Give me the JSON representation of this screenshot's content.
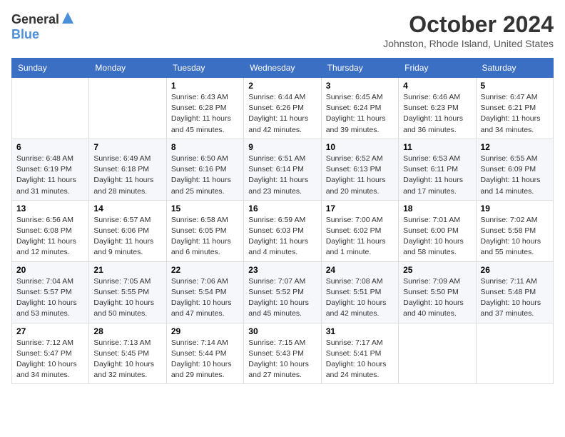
{
  "logo": {
    "general": "General",
    "blue": "Blue"
  },
  "title": "October 2024",
  "location": "Johnston, Rhode Island, United States",
  "days_of_week": [
    "Sunday",
    "Monday",
    "Tuesday",
    "Wednesday",
    "Thursday",
    "Friday",
    "Saturday"
  ],
  "weeks": [
    [
      {
        "day": "",
        "sunrise": "",
        "sunset": "",
        "daylight": ""
      },
      {
        "day": "",
        "sunrise": "",
        "sunset": "",
        "daylight": ""
      },
      {
        "day": "1",
        "sunrise": "Sunrise: 6:43 AM",
        "sunset": "Sunset: 6:28 PM",
        "daylight": "Daylight: 11 hours and 45 minutes."
      },
      {
        "day": "2",
        "sunrise": "Sunrise: 6:44 AM",
        "sunset": "Sunset: 6:26 PM",
        "daylight": "Daylight: 11 hours and 42 minutes."
      },
      {
        "day": "3",
        "sunrise": "Sunrise: 6:45 AM",
        "sunset": "Sunset: 6:24 PM",
        "daylight": "Daylight: 11 hours and 39 minutes."
      },
      {
        "day": "4",
        "sunrise": "Sunrise: 6:46 AM",
        "sunset": "Sunset: 6:23 PM",
        "daylight": "Daylight: 11 hours and 36 minutes."
      },
      {
        "day": "5",
        "sunrise": "Sunrise: 6:47 AM",
        "sunset": "Sunset: 6:21 PM",
        "daylight": "Daylight: 11 hours and 34 minutes."
      }
    ],
    [
      {
        "day": "6",
        "sunrise": "Sunrise: 6:48 AM",
        "sunset": "Sunset: 6:19 PM",
        "daylight": "Daylight: 11 hours and 31 minutes."
      },
      {
        "day": "7",
        "sunrise": "Sunrise: 6:49 AM",
        "sunset": "Sunset: 6:18 PM",
        "daylight": "Daylight: 11 hours and 28 minutes."
      },
      {
        "day": "8",
        "sunrise": "Sunrise: 6:50 AM",
        "sunset": "Sunset: 6:16 PM",
        "daylight": "Daylight: 11 hours and 25 minutes."
      },
      {
        "day": "9",
        "sunrise": "Sunrise: 6:51 AM",
        "sunset": "Sunset: 6:14 PM",
        "daylight": "Daylight: 11 hours and 23 minutes."
      },
      {
        "day": "10",
        "sunrise": "Sunrise: 6:52 AM",
        "sunset": "Sunset: 6:13 PM",
        "daylight": "Daylight: 11 hours and 20 minutes."
      },
      {
        "day": "11",
        "sunrise": "Sunrise: 6:53 AM",
        "sunset": "Sunset: 6:11 PM",
        "daylight": "Daylight: 11 hours and 17 minutes."
      },
      {
        "day": "12",
        "sunrise": "Sunrise: 6:55 AM",
        "sunset": "Sunset: 6:09 PM",
        "daylight": "Daylight: 11 hours and 14 minutes."
      }
    ],
    [
      {
        "day": "13",
        "sunrise": "Sunrise: 6:56 AM",
        "sunset": "Sunset: 6:08 PM",
        "daylight": "Daylight: 11 hours and 12 minutes."
      },
      {
        "day": "14",
        "sunrise": "Sunrise: 6:57 AM",
        "sunset": "Sunset: 6:06 PM",
        "daylight": "Daylight: 11 hours and 9 minutes."
      },
      {
        "day": "15",
        "sunrise": "Sunrise: 6:58 AM",
        "sunset": "Sunset: 6:05 PM",
        "daylight": "Daylight: 11 hours and 6 minutes."
      },
      {
        "day": "16",
        "sunrise": "Sunrise: 6:59 AM",
        "sunset": "Sunset: 6:03 PM",
        "daylight": "Daylight: 11 hours and 4 minutes."
      },
      {
        "day": "17",
        "sunrise": "Sunrise: 7:00 AM",
        "sunset": "Sunset: 6:02 PM",
        "daylight": "Daylight: 11 hours and 1 minute."
      },
      {
        "day": "18",
        "sunrise": "Sunrise: 7:01 AM",
        "sunset": "Sunset: 6:00 PM",
        "daylight": "Daylight: 10 hours and 58 minutes."
      },
      {
        "day": "19",
        "sunrise": "Sunrise: 7:02 AM",
        "sunset": "Sunset: 5:58 PM",
        "daylight": "Daylight: 10 hours and 55 minutes."
      }
    ],
    [
      {
        "day": "20",
        "sunrise": "Sunrise: 7:04 AM",
        "sunset": "Sunset: 5:57 PM",
        "daylight": "Daylight: 10 hours and 53 minutes."
      },
      {
        "day": "21",
        "sunrise": "Sunrise: 7:05 AM",
        "sunset": "Sunset: 5:55 PM",
        "daylight": "Daylight: 10 hours and 50 minutes."
      },
      {
        "day": "22",
        "sunrise": "Sunrise: 7:06 AM",
        "sunset": "Sunset: 5:54 PM",
        "daylight": "Daylight: 10 hours and 47 minutes."
      },
      {
        "day": "23",
        "sunrise": "Sunrise: 7:07 AM",
        "sunset": "Sunset: 5:52 PM",
        "daylight": "Daylight: 10 hours and 45 minutes."
      },
      {
        "day": "24",
        "sunrise": "Sunrise: 7:08 AM",
        "sunset": "Sunset: 5:51 PM",
        "daylight": "Daylight: 10 hours and 42 minutes."
      },
      {
        "day": "25",
        "sunrise": "Sunrise: 7:09 AM",
        "sunset": "Sunset: 5:50 PM",
        "daylight": "Daylight: 10 hours and 40 minutes."
      },
      {
        "day": "26",
        "sunrise": "Sunrise: 7:11 AM",
        "sunset": "Sunset: 5:48 PM",
        "daylight": "Daylight: 10 hours and 37 minutes."
      }
    ],
    [
      {
        "day": "27",
        "sunrise": "Sunrise: 7:12 AM",
        "sunset": "Sunset: 5:47 PM",
        "daylight": "Daylight: 10 hours and 34 minutes."
      },
      {
        "day": "28",
        "sunrise": "Sunrise: 7:13 AM",
        "sunset": "Sunset: 5:45 PM",
        "daylight": "Daylight: 10 hours and 32 minutes."
      },
      {
        "day": "29",
        "sunrise": "Sunrise: 7:14 AM",
        "sunset": "Sunset: 5:44 PM",
        "daylight": "Daylight: 10 hours and 29 minutes."
      },
      {
        "day": "30",
        "sunrise": "Sunrise: 7:15 AM",
        "sunset": "Sunset: 5:43 PM",
        "daylight": "Daylight: 10 hours and 27 minutes."
      },
      {
        "day": "31",
        "sunrise": "Sunrise: 7:17 AM",
        "sunset": "Sunset: 5:41 PM",
        "daylight": "Daylight: 10 hours and 24 minutes."
      },
      {
        "day": "",
        "sunrise": "",
        "sunset": "",
        "daylight": ""
      },
      {
        "day": "",
        "sunrise": "",
        "sunset": "",
        "daylight": ""
      }
    ]
  ]
}
